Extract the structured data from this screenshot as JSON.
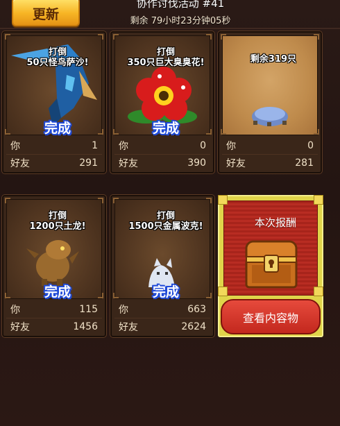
{
  "header": {
    "refresh_label": "更新",
    "event_title": "协作讨伐活动 #41",
    "remaining_time": "剩余 79小时23分钟05秒"
  },
  "stat_labels": {
    "you": "你",
    "friends": "好友"
  },
  "cards": [
    {
      "mission": "打倒\n50只怪鸟萨沙!",
      "status": "完成",
      "you": "1",
      "friends": "291"
    },
    {
      "mission": "打倒\n350只巨大臭臭花!",
      "status": "完成",
      "you": "0",
      "friends": "390"
    },
    {
      "mission": "剩余319只",
      "status": "",
      "you": "0",
      "friends": "281"
    },
    {
      "mission": "打倒\n1200只土龙!",
      "status": "完成",
      "you": "115",
      "friends": "1456"
    },
    {
      "mission": "打倒\n1500只金属波克!",
      "status": "完成",
      "you": "663",
      "friends": "2624"
    }
  ],
  "reward": {
    "title": "本次报酬",
    "view_button": "查看内容物"
  }
}
